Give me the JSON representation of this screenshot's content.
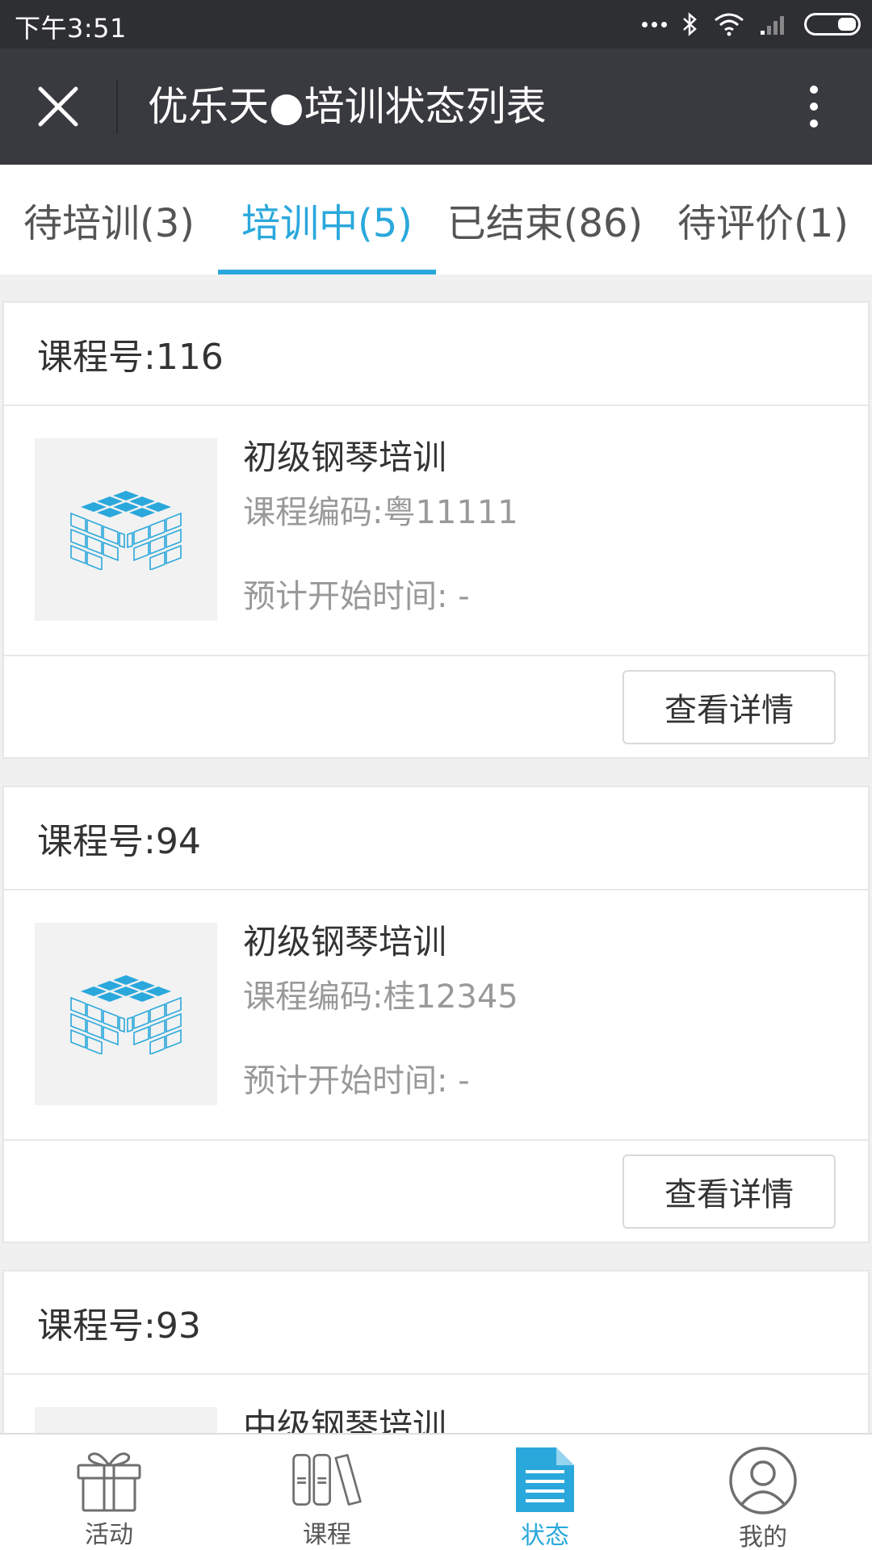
{
  "status_bar": {
    "time": "下午3:51"
  },
  "title_bar": {
    "title": "优乐天●培训状态列表"
  },
  "tabs": [
    {
      "label": "待培训(3)",
      "active": false
    },
    {
      "label": "培训中(5)",
      "active": true
    },
    {
      "label": "已结束(86)",
      "active": false
    },
    {
      "label": "待评价(1)",
      "active": false
    }
  ],
  "courses": [
    {
      "header": "课程号:116",
      "name": "初级钢琴培训",
      "code": "课程编码:粤11111",
      "start": "预计开始时间: -",
      "button": "查看详情"
    },
    {
      "header": "课程号:94",
      "name": "初级钢琴培训",
      "code": "课程编码:桂12345",
      "start": "预计开始时间: -",
      "button": "查看详情"
    },
    {
      "header": "课程号:93",
      "name": "中级钢琴培训",
      "code": "",
      "start": "",
      "button": ""
    }
  ],
  "bottom_nav": [
    {
      "label": "活动",
      "icon": "gift-icon",
      "active": false
    },
    {
      "label": "课程",
      "icon": "books-icon",
      "active": false
    },
    {
      "label": "状态",
      "icon": "document-icon",
      "active": true
    },
    {
      "label": "我的",
      "icon": "user-icon",
      "active": false
    }
  ],
  "colors": {
    "accent": "#2aa8dc",
    "title_bar": "#393a3f",
    "status_bar": "#2e2f33"
  }
}
